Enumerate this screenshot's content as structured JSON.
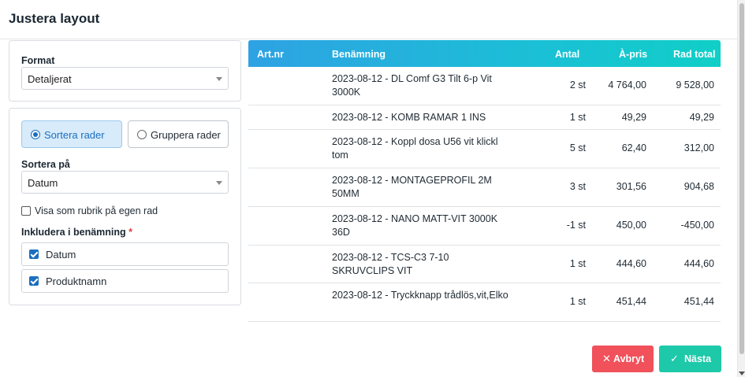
{
  "dialog": {
    "title": "Justera layout"
  },
  "format": {
    "label": "Format",
    "selected": "Detaljerat"
  },
  "sort_mode": {
    "sort_rows": "Sortera rader",
    "group_rows": "Gruppera rader",
    "active": "sort_rows"
  },
  "sort_on": {
    "label": "Sortera på",
    "selected": "Datum"
  },
  "show_as_heading": {
    "label": "Visa som rubrik på egen rad",
    "checked": false
  },
  "include": {
    "label": "Inkludera i benämning",
    "required_mark": "*",
    "options": [
      {
        "label": "Datum",
        "checked": true
      },
      {
        "label": "Produktnamn",
        "checked": true
      }
    ]
  },
  "table": {
    "headers": {
      "artnr": "Art.nr",
      "name": "Benämning",
      "qty": "Antal",
      "price": "À-pris",
      "total": "Rad total"
    },
    "rows": [
      {
        "artnr": "",
        "name": "2023-08-12 - DL Comf G3 Tilt 6-p Vit 3000K",
        "qty": "2 st",
        "price": "4 764,00",
        "total": "9 528,00"
      },
      {
        "artnr": "",
        "name": "2023-08-12 - KOMB RAMAR 1 INS",
        "qty": "1 st",
        "price": "49,29",
        "total": "49,29"
      },
      {
        "artnr": "",
        "name": "2023-08-12 - Koppl dosa U56 vit klickl tom",
        "qty": "5 st",
        "price": "62,40",
        "total": "312,00"
      },
      {
        "artnr": "",
        "name": "2023-08-12 - MONTAGEPROFIL 2M 50MM",
        "qty": "3 st",
        "price": "301,56",
        "total": "904,68"
      },
      {
        "artnr": "",
        "name": "2023-08-12 - NANO MATT-VIT 3000K 36D",
        "qty": "-1 st",
        "price": "450,00",
        "total": "-450,00"
      },
      {
        "artnr": "",
        "name": "2023-08-12 - TCS-C3 7-10 SKRUVCLIPS VIT",
        "qty": "1 st",
        "price": "444,60",
        "total": "444,60"
      },
      {
        "artnr": "",
        "name": "2023-08-12 - Tryckknapp trådlös,vit,Elko",
        "qty": "1 st",
        "price": "451,44",
        "total": "451,44"
      }
    ]
  },
  "actions": {
    "cancel": "Avbryt",
    "next": "Nästa"
  },
  "icons": {
    "cancel": "close-icon",
    "next": "check-icon"
  },
  "colors": {
    "accent": "#1a6fc0",
    "cancel": "#f0515a",
    "next": "#1dc9a8",
    "header_start": "#2ea2e3",
    "header_end": "#10cfc7"
  }
}
